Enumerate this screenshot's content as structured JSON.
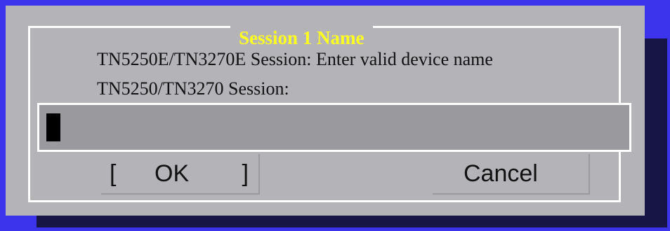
{
  "dialog": {
    "title": "Session 1 Name",
    "line1": "TN5250E/TN3270E Session: Enter valid device name",
    "line2": "TN5250/TN3270 Session:",
    "input": {
      "value": ""
    },
    "buttons": {
      "ok": {
        "bracket_left": "[",
        "label": "OK",
        "bracket_right": "]"
      },
      "cancel": {
        "label": "Cancel"
      }
    }
  },
  "colors": {
    "background": "#3c33ec",
    "shadow": "#171446",
    "dialog": "#b4b4b8",
    "title": "#ffff22",
    "input_field": "#9a9a9e",
    "frame": "#ffffff"
  }
}
